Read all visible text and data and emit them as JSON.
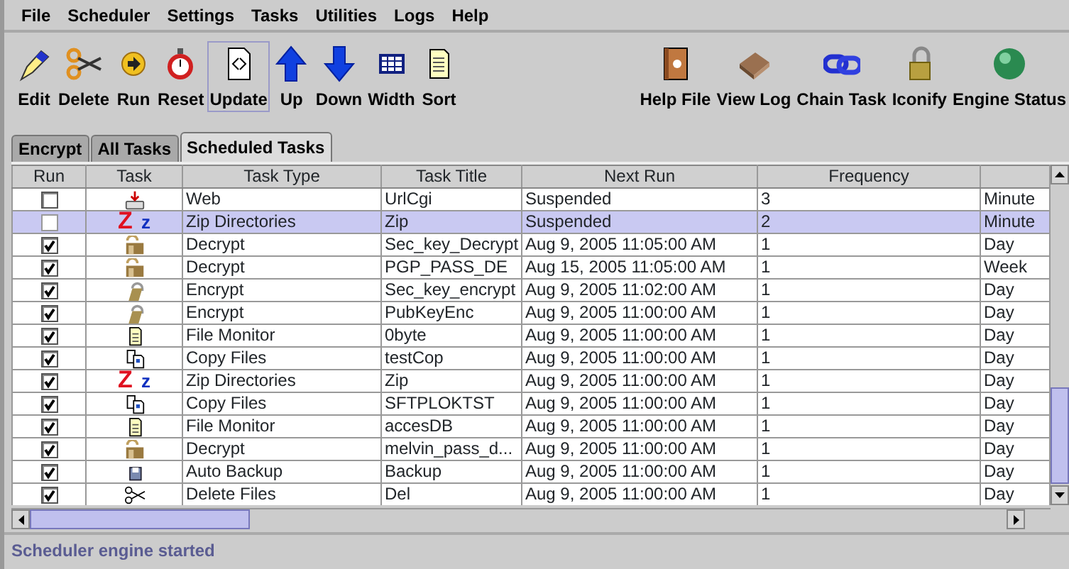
{
  "menu": [
    "File",
    "Scheduler",
    "Settings",
    "Tasks",
    "Utilities",
    "Logs",
    "Help"
  ],
  "toolbar_left": [
    {
      "label": "Edit",
      "kind": "pen",
      "selected": false
    },
    {
      "label": "Delete",
      "kind": "scissors",
      "selected": false
    },
    {
      "label": "Run",
      "kind": "run",
      "selected": false
    },
    {
      "label": "Reset",
      "kind": "stopwatch",
      "selected": false
    },
    {
      "label": "Update",
      "kind": "document",
      "selected": true
    },
    {
      "label": "Up",
      "kind": "up",
      "selected": false
    },
    {
      "label": "Down",
      "kind": "down",
      "selected": false
    },
    {
      "label": "Width",
      "kind": "grid",
      "selected": false
    },
    {
      "label": "Sort",
      "kind": "note",
      "selected": false
    }
  ],
  "toolbar_right": [
    {
      "label": "Help File",
      "kind": "book",
      "selected": false
    },
    {
      "label": "View Log",
      "kind": "box",
      "selected": false
    },
    {
      "label": "Chain Task",
      "kind": "chain",
      "selected": false
    },
    {
      "label": "Iconify",
      "kind": "padlock",
      "selected": false
    },
    {
      "label": "Engine Status",
      "kind": "sphere",
      "selected": false
    }
  ],
  "tabs": [
    {
      "label": "Encrypt",
      "selected": false
    },
    {
      "label": "All Tasks",
      "selected": false
    },
    {
      "label": "Scheduled Tasks",
      "selected": true
    }
  ],
  "table": {
    "columns": [
      "Run",
      "Task",
      "Task Type",
      "Task Title",
      "Next Run",
      "Frequency"
    ],
    "rows": [
      {
        "checked": false,
        "selected": false,
        "kind": "web",
        "task_type": "Web",
        "task_title": "UrlCgi",
        "next_run": "Suspended",
        "frequency": "3",
        "column_7": "Minute"
      },
      {
        "checked": false,
        "selected": true,
        "kind": "zip",
        "icon_text": [
          "Z",
          "z"
        ],
        "task_type": "Zip Directories",
        "task_title": "Zip",
        "next_run": "Suspended",
        "frequency": "2",
        "column_7": "Minute"
      },
      {
        "checked": true,
        "selected": false,
        "kind": "decrypt",
        "task_type": "Decrypt",
        "task_title": "Sec_key_Decrypt",
        "next_run": "Aug 9, 2005 11:05:00 AM",
        "frequency": "1",
        "column_7": "Day"
      },
      {
        "checked": true,
        "selected": false,
        "kind": "decrypt",
        "task_type": "Decrypt",
        "task_title": "PGP_PASS_DE",
        "next_run": "Aug 15, 2005 11:05:00 AM",
        "frequency": "1",
        "column_7": "Week"
      },
      {
        "checked": true,
        "selected": false,
        "kind": "encrypt",
        "task_type": "Encrypt",
        "task_title": "Sec_key_encrypt",
        "next_run": "Aug 9, 2005 11:02:00 AM",
        "frequency": "1",
        "column_7": "Day"
      },
      {
        "checked": true,
        "selected": false,
        "kind": "encrypt",
        "task_type": "Encrypt",
        "task_title": "PubKeyEnc",
        "next_run": "Aug 9, 2005 11:00:00 AM",
        "frequency": "1",
        "column_7": "Day"
      },
      {
        "checked": true,
        "selected": false,
        "kind": "monitor",
        "task_type": "File Monitor",
        "task_title": "0byte",
        "next_run": "Aug 9, 2005 11:00:00 AM",
        "frequency": "1",
        "column_7": "Day"
      },
      {
        "checked": true,
        "selected": false,
        "kind": "copy",
        "task_type": "Copy Files",
        "task_title": "testCop",
        "next_run": "Aug 9, 2005 11:00:00 AM",
        "frequency": "1",
        "column_7": "Day"
      },
      {
        "checked": true,
        "selected": false,
        "kind": "zip",
        "icon_text": [
          "Z",
          "z"
        ],
        "task_type": "Zip Directories",
        "task_title": "Zip",
        "next_run": "Aug 9, 2005 11:00:00 AM",
        "frequency": "1",
        "column_7": "Day"
      },
      {
        "checked": true,
        "selected": false,
        "kind": "copy",
        "task_type": "Copy Files",
        "task_title": "SFTPLOKTST",
        "next_run": "Aug 9, 2005 11:00:00 AM",
        "frequency": "1",
        "column_7": "Day"
      },
      {
        "checked": true,
        "selected": false,
        "kind": "monitor",
        "task_type": "File Monitor",
        "task_title": "accesDB",
        "next_run": "Aug 9, 2005 11:00:00 AM",
        "frequency": "1",
        "column_7": "Day"
      },
      {
        "checked": true,
        "selected": false,
        "kind": "decrypt",
        "task_type": "Decrypt",
        "task_title": "melvin_pass_d...",
        "next_run": "Aug 9, 2005 11:00:00 AM",
        "frequency": "1",
        "column_7": "Day"
      },
      {
        "checked": true,
        "selected": false,
        "kind": "backup",
        "task_type": "Auto Backup",
        "task_title": "Backup",
        "next_run": "Aug 9, 2005 11:00:00 AM",
        "frequency": "1",
        "column_7": "Day"
      },
      {
        "checked": true,
        "selected": false,
        "kind": "delete",
        "task_type": "Delete Files",
        "task_title": "Del",
        "next_run": "Aug 9, 2005 11:00:00 AM",
        "frequency": "1",
        "column_7": "Day"
      }
    ]
  },
  "status_bar": "Scheduler engine started"
}
